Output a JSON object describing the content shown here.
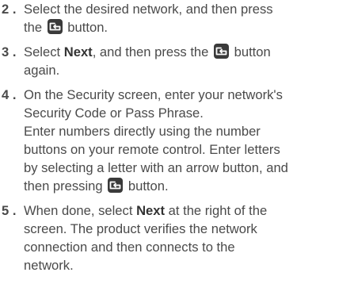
{
  "steps": [
    {
      "number": "2 .",
      "lines": [
        {
          "a": "Select the desired network, and then press"
        },
        {
          "a": "the ",
          "icon": "enter-button-icon",
          "b": " button."
        }
      ]
    },
    {
      "number": "3 .",
      "lines": [
        {
          "a": "Select ",
          "bold": "Next",
          "b": ", and then press the ",
          "icon": "enter-button-icon",
          "c": " button"
        },
        {
          "a": "again."
        }
      ]
    },
    {
      "number": "4 .",
      "lines": [
        {
          "a": "On the Security screen, enter your network's"
        },
        {
          "a": "Security Code or Pass Phrase."
        },
        {
          "a": "Enter numbers directly using the number"
        },
        {
          "a": "buttons on your remote control. Enter letters"
        },
        {
          "a": "by selecting a letter with an arrow button, and"
        },
        {
          "a": "then pressing ",
          "icon": "enter-button-icon",
          "b": " button."
        }
      ]
    },
    {
      "number": "5 .",
      "lines": [
        {
          "a": "When done, select ",
          "bold": "Next",
          "b": " at the right of the"
        },
        {
          "a": "screen. The product verifies the network"
        },
        {
          "a": "connection and then connects to the"
        },
        {
          "a": "network."
        }
      ]
    }
  ]
}
